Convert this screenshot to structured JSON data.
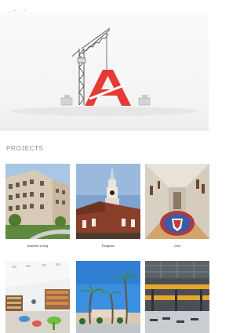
{
  "header": {
    "logo_icon": "brand-logo-mark",
    "accent_color": "#e63b35"
  },
  "hero": {
    "image_description_icon": "crane-letter-a-icon"
  },
  "projects": {
    "title": "PROJECTS",
    "items": [
      {
        "label": "Assisted Living",
        "icon": "apartment-building-photo"
      },
      {
        "label": "Religious",
        "icon": "church-steeple-photo"
      },
      {
        "label": "Civic",
        "icon": "hallway-seal-photo"
      },
      {
        "label": "",
        "icon": "library-interior-photo"
      },
      {
        "label": "",
        "icon": "palm-trees-building-photo"
      },
      {
        "label": "",
        "icon": "warehouse-interior-photo"
      }
    ]
  }
}
